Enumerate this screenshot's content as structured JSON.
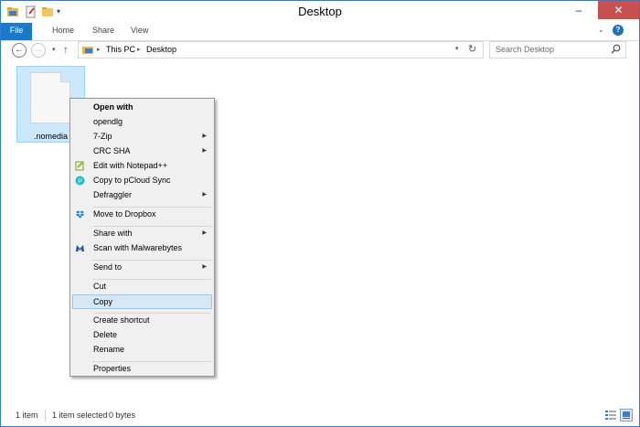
{
  "window": {
    "title": "Desktop"
  },
  "ribbon": {
    "tabs": [
      "File",
      "Home",
      "Share",
      "View"
    ]
  },
  "address": {
    "crumbs": [
      "This PC",
      "Desktop"
    ],
    "separator": "▸",
    "search_placeholder": "Search Desktop"
  },
  "file": {
    "name": ".nomedia"
  },
  "context_menu": {
    "items": [
      {
        "label": "Open with",
        "bold": true
      },
      {
        "label": "opendlg"
      },
      {
        "label": "7-Zip",
        "submenu": true
      },
      {
        "label": "CRC SHA",
        "submenu": true
      },
      {
        "label": "Edit with Notepad++",
        "icon": "notepadpp-icon"
      },
      {
        "label": "Copy to pCloud Sync",
        "icon": "pcloud-icon"
      },
      {
        "label": "Defraggler",
        "submenu": true
      },
      {
        "label": "Move to Dropbox",
        "icon": "dropbox-icon"
      },
      {
        "label": "Share with",
        "submenu": true
      },
      {
        "label": "Scan with Malwarebytes",
        "icon": "malwarebytes-icon"
      },
      {
        "label": "Send to",
        "submenu": true
      },
      {
        "label": "Cut"
      },
      {
        "label": "Copy",
        "highlighted": true
      },
      {
        "label": "Create shortcut"
      },
      {
        "label": "Delete"
      },
      {
        "label": "Rename"
      },
      {
        "label": "Properties"
      }
    ]
  },
  "status": {
    "item_count": "1 item",
    "selection": "1 item selected",
    "size": "0 bytes"
  },
  "colors": {
    "file_tab": "#1979ca",
    "selection_bg": "#cce8ff",
    "menu_highlight": "#d6e7f6"
  }
}
